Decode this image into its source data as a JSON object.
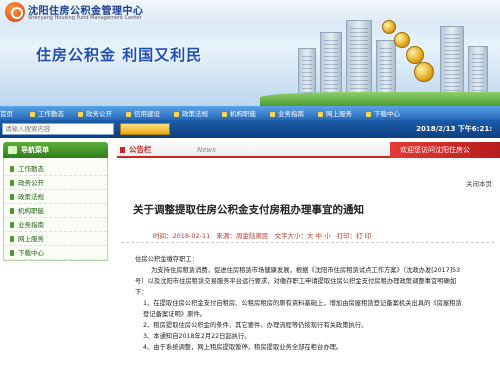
{
  "header": {
    "org_name": "沈阳住房公积金管理中心",
    "org_en": "Shenyang Housing Fund Management Center",
    "slogan": "住房公积金  利国又利民"
  },
  "nav": {
    "items": [
      "首页",
      "工作動态",
      "政务公开",
      "信用建设",
      "政策法规",
      "机构职能",
      "业务指南",
      "网上服务",
      "下载中心"
    ]
  },
  "search": {
    "placeholder": "请输入搜索内容",
    "button_label": "",
    "datetime": "2018/2/13 下午6:21:"
  },
  "sidebar": {
    "title": "导航菜单",
    "items": [
      "工作動态",
      "政务公开",
      "政策法规",
      "机构职能",
      "业务指南",
      "网上服务",
      "下载中心"
    ]
  },
  "main": {
    "tab_active": "公告栏",
    "tab_news": "News",
    "welcome": "欢迎您访问沈阳住房公",
    "close_link": "关闭本页",
    "article_title": "关于调整提取住房公积金支付房租办理事宜的通知",
    "meta": {
      "time": "时间：2018-02-11",
      "source": "来源：周金陆离民",
      "font_size": "文字大小：大 中 小",
      "print": "打印：打 印"
    },
    "paragraphs": [
      "住房公积金缴存职工：",
      "为支持住房租赁消费，促进住房租赁市场健康发展，根据《沈阳市住房租赁试点工作方案》（沈政办发[2017]53号）以及沈阳市住房租赁交易服务平台运行要求，对缴存职工申请提取住房公积金支付房租办理政策调整事宜明确如下：",
      "1、在提取住房公积金支付自租房、公租房租房的原有资料基础上，增加由房屋租赁登记备案机关出具的《房屋租赁登记备案证明》原件。",
      "2、租房提取住房公积金的条件、其它要件、办理流程等仍按现行有关政策执行。",
      "3、本通知自2018年2月22日起执行。",
      "4、由于系统调整，网上租房提取暂停，租房提取业务全部在柜台办理。"
    ]
  }
}
